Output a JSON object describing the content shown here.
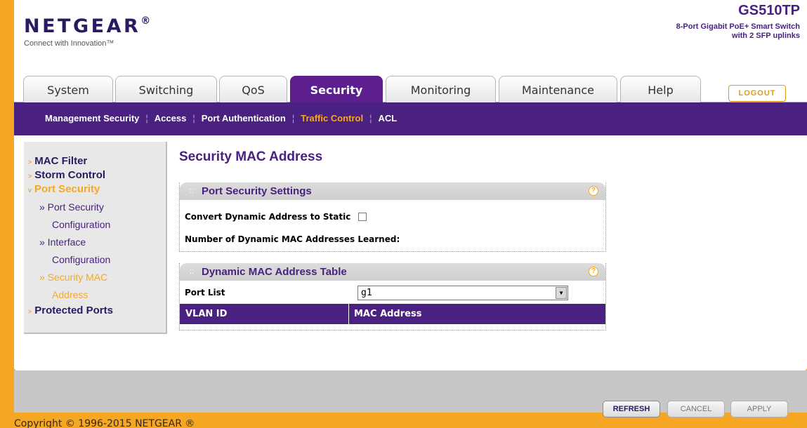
{
  "brand": {
    "logo": "NETGEAR",
    "registered": "®",
    "tagline": "Connect with Innovation™",
    "model": "GS510TP",
    "model_desc_line1": "8-Port Gigabit PoE+ Smart Switch",
    "model_desc_line2": "with 2 SFP uplinks"
  },
  "tabs": [
    {
      "label": "System"
    },
    {
      "label": "Switching"
    },
    {
      "label": "QoS"
    },
    {
      "label": "Security"
    },
    {
      "label": "Monitoring"
    },
    {
      "label": "Maintenance"
    },
    {
      "label": "Help"
    }
  ],
  "active_tab": "Security",
  "logout_label": "LOGOUT",
  "subnav": [
    {
      "label": "Management Security"
    },
    {
      "label": "Access"
    },
    {
      "label": "Port Authentication"
    },
    {
      "label": "Traffic Control"
    },
    {
      "label": "ACL"
    }
  ],
  "sidebar": {
    "mac_filter": "MAC Filter",
    "storm_control": "Storm Control",
    "port_security": "Port Security",
    "port_security_config_1": "» Port Security",
    "port_security_config_2": "Configuration",
    "interface_config_1": "» Interface",
    "interface_config_2": "Configuration",
    "security_mac_1": "» Security MAC",
    "security_mac_2": "Address",
    "protected_ports": "Protected Ports"
  },
  "main": {
    "title": "Security MAC Address",
    "settings_panel": {
      "heading": "Port Security Settings",
      "convert_label": "Convert Dynamic Address to Static",
      "learned_label": "Number of Dynamic MAC Addresses Learned:"
    },
    "table_panel": {
      "heading": "Dynamic MAC Address Table",
      "port_list_label": "Port List",
      "port_list_value": "g1",
      "columns": [
        "VLAN ID",
        "MAC Address"
      ]
    }
  },
  "buttons": {
    "refresh": "REFRESH",
    "cancel": "CANCEL",
    "apply": "APPLY"
  },
  "copyright": "Copyright © 1996-2015 NETGEAR ®",
  "colors": {
    "purple": "#4a2180",
    "orange": "#f7a821",
    "frame": "#f5a623"
  }
}
